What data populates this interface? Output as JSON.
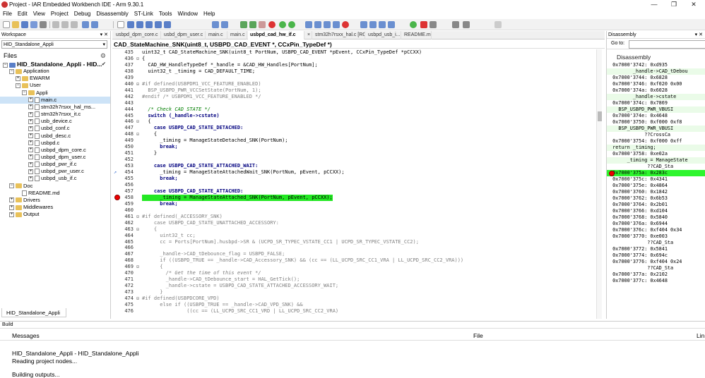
{
  "window": {
    "title": "Project - IAR Embedded Workbench IDE - Arm 9.30.1"
  },
  "menu": [
    "File",
    "Edit",
    "View",
    "Project",
    "Debug",
    "Disassembly",
    "ST-Link",
    "Tools",
    "Window",
    "Help"
  ],
  "workspace": {
    "header": "Workspace",
    "config": "HID_Standalone_Appli",
    "files_label": "Files",
    "tree": [
      {
        "label": "HID_Standalone_Appli - HID...",
        "depth": 0,
        "kind": "project",
        "exp": "-",
        "check": true
      },
      {
        "label": "Application",
        "depth": 1,
        "kind": "folder",
        "exp": "-"
      },
      {
        "label": "EWARM",
        "depth": 2,
        "kind": "folder",
        "exp": "+"
      },
      {
        "label": "User",
        "depth": 2,
        "kind": "folder",
        "exp": "-"
      },
      {
        "label": "Appli",
        "depth": 3,
        "kind": "folder",
        "exp": "-"
      },
      {
        "label": "main.c",
        "depth": 4,
        "kind": "file",
        "exp": "+",
        "selected": true
      },
      {
        "label": "stm32h7rsxx_hal_ms...",
        "depth": 4,
        "kind": "file",
        "exp": "+"
      },
      {
        "label": "stm32h7rsxx_it.c",
        "depth": 4,
        "kind": "file",
        "exp": "+"
      },
      {
        "label": "usb_device.c",
        "depth": 4,
        "kind": "file",
        "exp": "+"
      },
      {
        "label": "usbd_conf.c",
        "depth": 4,
        "kind": "file",
        "exp": "+"
      },
      {
        "label": "usbd_desc.c",
        "depth": 4,
        "kind": "file",
        "exp": "+"
      },
      {
        "label": "usbpd.c",
        "depth": 4,
        "kind": "file",
        "exp": "+"
      },
      {
        "label": "usbpd_dpm_core.c",
        "depth": 4,
        "kind": "file",
        "exp": "+"
      },
      {
        "label": "usbpd_dpm_user.c",
        "depth": 4,
        "kind": "file",
        "exp": "+"
      },
      {
        "label": "usbpd_pwr_if.c",
        "depth": 4,
        "kind": "file",
        "exp": "+"
      },
      {
        "label": "usbpd_pwr_user.c",
        "depth": 4,
        "kind": "file",
        "exp": "+"
      },
      {
        "label": "usbpd_usb_if.c",
        "depth": 4,
        "kind": "file",
        "exp": "+"
      },
      {
        "label": "Doc",
        "depth": 1,
        "kind": "folder",
        "exp": "-"
      },
      {
        "label": "README.md",
        "depth": 2,
        "kind": "file",
        "exp": ""
      },
      {
        "label": "Drivers",
        "depth": 1,
        "kind": "folder",
        "exp": "+"
      },
      {
        "label": "Middlewares",
        "depth": 1,
        "kind": "folder",
        "exp": "+"
      },
      {
        "label": "Output",
        "depth": 1,
        "kind": "folder",
        "exp": "+"
      }
    ],
    "bottom_tab": "HID_Standalone_Appli"
  },
  "editor": {
    "tabs": [
      {
        "label": "usbpd_dpm_core.c",
        "active": false
      },
      {
        "label": "usbd_dpm_user.c",
        "active": false
      },
      {
        "label": "main.c",
        "active": false
      },
      {
        "label": "main.c",
        "active": false
      },
      {
        "label": "usbpd_cad_hw_if.c",
        "active": true
      },
      {
        "label": "×",
        "active": false
      },
      {
        "label": "stm32h7rsxx_hal.c [RO]",
        "active": false
      },
      {
        "label": "usbpd_usb_i...",
        "active": false
      },
      {
        "label": "README.md",
        "active": false
      }
    ],
    "function": "CAD_StateMachine_SNK(uint8_t, USBPD_CAD_EVENT *, CCxPin_TypeDef *)",
    "lines": [
      {
        "n": "435",
        "f": "",
        "t": "uint32_t CAD_StateMachine_SNK(uint8_t PortNum, USBPD_CAD_EVENT *pEvent, CCxPin_TypeDef *pCCXX)",
        "c": ""
      },
      {
        "n": "436",
        "f": "⊟",
        "t": "{",
        "c": ""
      },
      {
        "n": "437",
        "f": "",
        "t": "  CAD_HW_HandleTypeDef *_handle = &CAD_HW_Handles[PortNum];",
        "c": ""
      },
      {
        "n": "438",
        "f": "",
        "t": "  uint32_t _timing = CAD_DEFAULT_TIME;",
        "c": ""
      },
      {
        "n": "439",
        "f": "",
        "t": "",
        "c": ""
      },
      {
        "n": "440",
        "f": "⊟",
        "t": "#if defined(USBPDM1_VCC_FEATURE_ENABLED)",
        "c": "pp"
      },
      {
        "n": "441",
        "f": "",
        "t": "  BSP_USBPD_PWR_VCCSetState(PortNum, 1);",
        "c": "pp"
      },
      {
        "n": "442",
        "f": "",
        "t": "#endif /* USBPDM1_VCC_FEATURE_ENABLED */",
        "c": "pp"
      },
      {
        "n": "443",
        "f": "",
        "t": "",
        "c": ""
      },
      {
        "n": "444",
        "f": "",
        "t": "  /* Check CAD STATE */",
        "c": "cmt"
      },
      {
        "n": "445",
        "f": "",
        "t": "  switch (_handle->cstate)",
        "c": "kw"
      },
      {
        "n": "446",
        "f": "⊟",
        "t": "  {",
        "c": ""
      },
      {
        "n": "447",
        "f": "",
        "t": "    case USBPD_CAD_STATE_DETACHED:",
        "c": "kw"
      },
      {
        "n": "448",
        "f": "⊟",
        "t": "    {",
        "c": ""
      },
      {
        "n": "449",
        "f": "",
        "t": "      _timing = ManageStateDetached_SNK(PortNum);",
        "c": ""
      },
      {
        "n": "450",
        "f": "",
        "t": "      break;",
        "c": "kw"
      },
      {
        "n": "451",
        "f": "",
        "t": "    }",
        "c": ""
      },
      {
        "n": "452",
        "f": "",
        "t": "",
        "c": ""
      },
      {
        "n": "453",
        "f": "",
        "t": "    case USBPD_CAD_STATE_ATTACHED_WAIT:",
        "c": "kw"
      },
      {
        "n": "454",
        "f": "",
        "t": "      _timing = ManageStateAttachedWait_SNK(PortNum, pEvent, pCCXX);",
        "c": ""
      },
      {
        "n": "455",
        "f": "",
        "t": "      break;",
        "c": "kw"
      },
      {
        "n": "456",
        "f": "",
        "t": "",
        "c": ""
      },
      {
        "n": "457",
        "f": "",
        "t": "    case USBPD_CAD_STATE_ATTACHED:",
        "c": "kw"
      },
      {
        "n": "458",
        "f": "",
        "t": "      _timing = ManageStateAttached_SNK(PortNum, pEvent, pCCXX);",
        "c": "hl"
      },
      {
        "n": "459",
        "f": "",
        "t": "      break;",
        "c": "kw"
      },
      {
        "n": "460",
        "f": "",
        "t": "",
        "c": ""
      },
      {
        "n": "461",
        "f": "⊟",
        "t": "#if defined(_ACCESSORY_SNK)",
        "c": "pp"
      },
      {
        "n": "462",
        "f": "",
        "t": "    case USBPD_CAD_STATE_UNATTACHED_ACCESSORY:",
        "c": "pp"
      },
      {
        "n": "463",
        "f": "⊟",
        "t": "    {",
        "c": "pp"
      },
      {
        "n": "464",
        "f": "",
        "t": "      uint32_t cc;",
        "c": "pp"
      },
      {
        "n": "465",
        "f": "",
        "t": "      cc = Ports[PortNum].husbpd->SR & (UCPD_SR_TYPEC_VSTATE_CC1 | UCPD_SR_TYPEC_VSTATE_CC2);",
        "c": "pp"
      },
      {
        "n": "466",
        "f": "",
        "t": "",
        "c": ""
      },
      {
        "n": "467",
        "f": "",
        "t": "      _handle->CAD_tDebounce_flag = USBPD_FALSE;",
        "c": "pp"
      },
      {
        "n": "468",
        "f": "",
        "t": "      if ((USBPD_TRUE == _handle->CAD_Accessory_SNK) && (cc == (LL_UCPD_SRC_CC1_VRA | LL_UCPD_SRC_CC2_VRA)))",
        "c": "pp"
      },
      {
        "n": "469",
        "f": "⊟",
        "t": "      {",
        "c": "pp"
      },
      {
        "n": "470",
        "f": "",
        "t": "        /* Get the time of this event */",
        "c": "cmtg"
      },
      {
        "n": "471",
        "f": "",
        "t": "        _handle->CAD_tDebounce_start = HAL_GetTick();",
        "c": "pp"
      },
      {
        "n": "472",
        "f": "",
        "t": "        _handle->cstate = USBPD_CAD_STATE_ATTACHED_ACCESSORY_WAIT;",
        "c": "pp"
      },
      {
        "n": "473",
        "f": "",
        "t": "      }",
        "c": "pp"
      },
      {
        "n": "474",
        "f": "⊟",
        "t": "#if defined(USBPDCORE_VPD)",
        "c": "pp"
      },
      {
        "n": "475",
        "f": "",
        "t": "      else if ((USBPD_TRUE == _handle->CAD_VPD_SNK) &&",
        "c": "pp"
      },
      {
        "n": "476",
        "f": "",
        "t": "               ((cc == (LL_UCPD_SRC_CC1_VRD | LL_UCPD_SRC_CC2_VRA)",
        "c": "pp"
      }
    ]
  },
  "disassembly": {
    "header": "Disassembly",
    "goto_label": "Go to:",
    "title": "Disassembly",
    "rows": [
      {
        "t": "  0x7000'3742: 0xd935",
        "k": ""
      },
      {
        "t": "         _handle->CAD_tDebou",
        "k": "g"
      },
      {
        "t": "  0x7000'3744: 0x6828",
        "k": ""
      },
      {
        "t": "  0x7000'3746: 0xf020 0x00",
        "k": ""
      },
      {
        "t": "  0x7000'374a: 0x6028",
        "k": ""
      },
      {
        "t": "         _handle->cstate",
        "k": "g"
      },
      {
        "t": "  0x7000'374c: 0x7869",
        "k": ""
      },
      {
        "t": "    BSP_USBPD_PWR_VBUSI",
        "k": "g"
      },
      {
        "t": "  0x7000'374e: 0x4648",
        "k": ""
      },
      {
        "t": "  0x7000'3750: 0xf000 0xf8",
        "k": ""
      },
      {
        "t": "    BSP_USBPD_PWR_VBUSI",
        "k": "g"
      },
      {
        "t": "             ??CrossCa",
        "k": ""
      },
      {
        "t": "  0x7000'3754: 0xf000 0xff",
        "k": ""
      },
      {
        "t": "  return _timing;",
        "k": "g"
      },
      {
        "t": "  0x7000'3758: 0xe02a",
        "k": ""
      },
      {
        "t": "       _timing = ManageState",
        "k": "g"
      },
      {
        "t": "              ??CAD_Sta",
        "k": ""
      },
      {
        "t": "  0x7000'375a: 0x283c",
        "k": "cur"
      },
      {
        "t": "  0x7000'375c: 0x4341",
        "k": ""
      },
      {
        "t": "  0x7000'375e: 0x4864",
        "k": ""
      },
      {
        "t": "  0x7000'3760: 0x1842",
        "k": ""
      },
      {
        "t": "  0x7000'3762: 0x6b53",
        "k": ""
      },
      {
        "t": "  0x7000'3764: 0x2b01",
        "k": ""
      },
      {
        "t": "  0x7000'3766: 0xd104",
        "k": ""
      },
      {
        "t": "  0x7000'3768: 0x5840",
        "k": ""
      },
      {
        "t": "  0x7000'376a: 0x6944",
        "k": ""
      },
      {
        "t": "  0x7000'376c: 0xf404 0x34",
        "k": ""
      },
      {
        "t": "  0x7000'3770: 0xe003",
        "k": ""
      },
      {
        "t": "              ??CAD_Sta",
        "k": ""
      },
      {
        "t": "  0x7000'3772: 0x5841",
        "k": ""
      },
      {
        "t": "  0x7000'3774: 0x694c",
        "k": ""
      },
      {
        "t": "  0x7000'3776: 0xf404 0x24",
        "k": ""
      },
      {
        "t": "              ??CAD_Sta",
        "k": ""
      },
      {
        "t": "  0x7000'377a: 0x2102",
        "k": ""
      },
      {
        "t": "  0x7000'377c: 0x4648",
        "k": ""
      }
    ]
  },
  "build": {
    "header": "Build",
    "col_messages": "Messages",
    "col_file": "File",
    "col_line": "Lin",
    "messages": [
      "HID_Standalone_Appli - HID_Standalone_Appli",
      "Reading project nodes...",
      "Building outputs..."
    ]
  }
}
